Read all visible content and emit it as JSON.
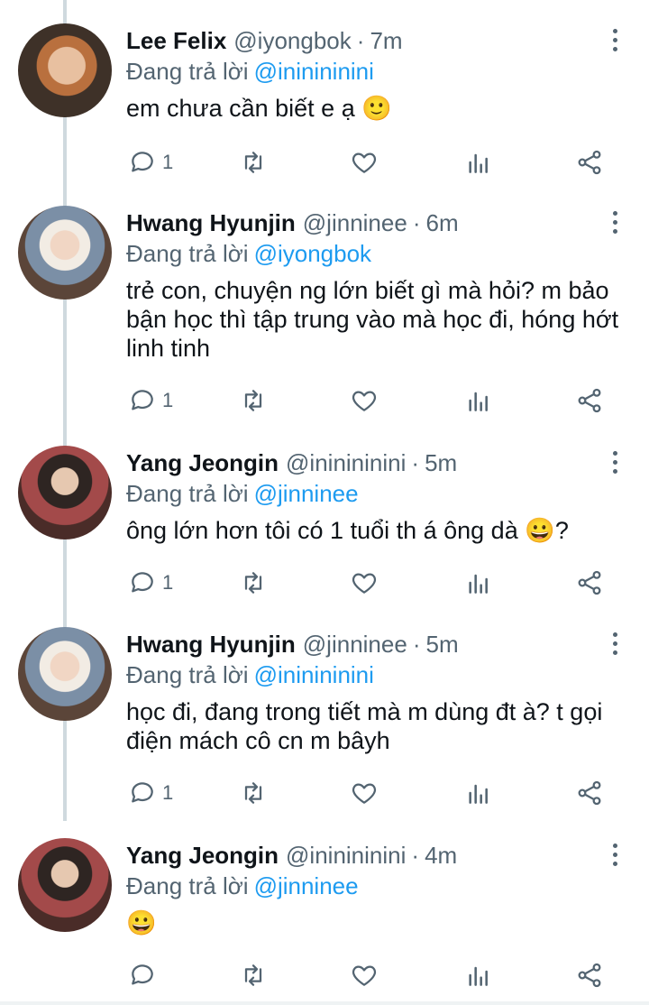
{
  "tweets": [
    {
      "name": "Lee Felix",
      "handle": "@iyongbok",
      "time": "7m",
      "reply_prefix": "Đang trả lời",
      "reply_to": "@ininininini",
      "text": "em chưa cần biết e ạ 🙂",
      "reply_count": "1"
    },
    {
      "name": "Hwang Hyunjin",
      "handle": "@jinninee",
      "time": "6m",
      "reply_prefix": "Đang trả lời",
      "reply_to": "@iyongbok",
      "text": "trẻ con, chuyện ng lớn biết gì mà hỏi? m bảo bận học thì tập trung vào mà học đi, hóng hớt linh tinh",
      "reply_count": "1"
    },
    {
      "name": "Yang Jeongin",
      "handle": "@ininininini",
      "time": "5m",
      "reply_prefix": "Đang trả lời",
      "reply_to": "@jinninee",
      "text": "ông lớn hơn tôi có 1 tuổi th á ông dà 😀?",
      "reply_count": "1"
    },
    {
      "name": "Hwang Hyunjin",
      "handle": "@jinninee",
      "time": "5m",
      "reply_prefix": "Đang trả lời",
      "reply_to": "@ininininini",
      "text": "học đi, đang trong tiết mà m dùng đt à? t gọi điện mách cô cn m bâyh",
      "reply_count": "1"
    },
    {
      "name": "Yang Jeongin",
      "handle": "@ininininini",
      "time": "4m",
      "reply_prefix": "Đang trả lời",
      "reply_to": "@jinninee",
      "text": "😀",
      "reply_count": ""
    }
  ],
  "icons": {
    "reply": "reply-icon",
    "retweet": "retweet-icon",
    "like": "heart-icon",
    "stats": "analytics-icon",
    "share": "share-icon",
    "more": "more-vertical-icon"
  },
  "colors": {
    "mention": "#1d9bf0",
    "secondary_text": "#536471",
    "thread_line": "#cfd9de"
  }
}
